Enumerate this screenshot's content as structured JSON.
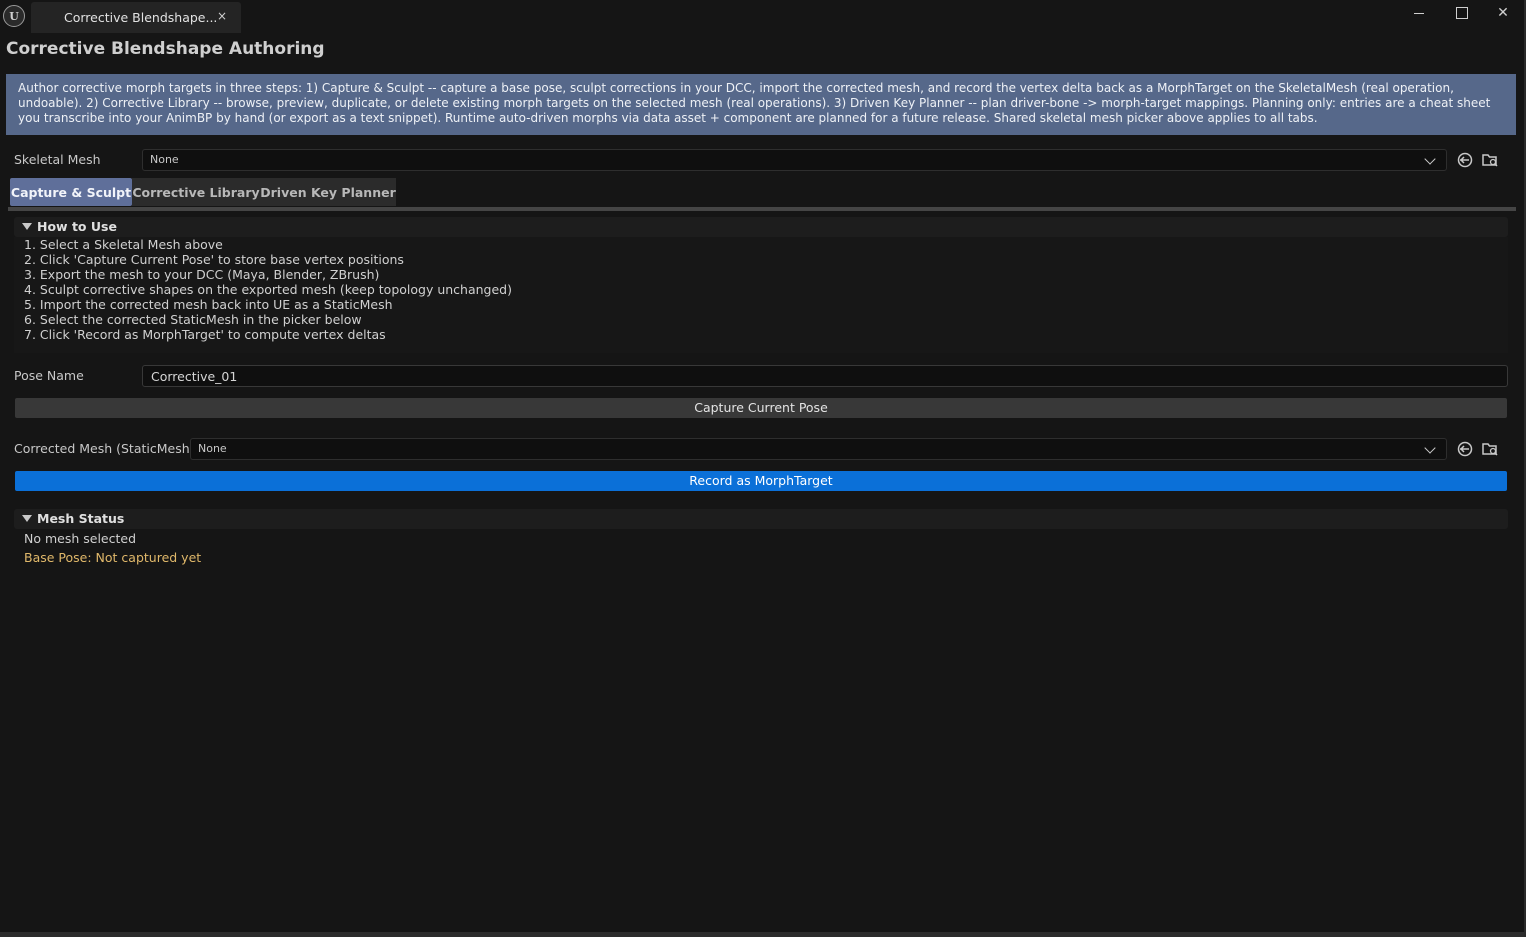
{
  "window": {
    "logo_text": "U",
    "tab_title": "Corrective Blendshape...",
    "tab_close": "×",
    "close_glyph": "✕"
  },
  "page": {
    "title": "Corrective Blendshape Authoring",
    "info_text": "Author corrective morph targets in three steps: 1) Capture & Sculpt -- capture a base pose, sculpt corrections in your DCC, import the corrected mesh, and record the vertex delta back as a MorphTarget on the SkeletalMesh (real operation, undoable). 2) Corrective Library -- browse, preview, duplicate, or delete existing morph targets on the selected mesh (real operations). 3) Driven Key Planner -- plan driver-bone -> morph-target mappings. Planning only: entries are a cheat sheet you transcribe into your AnimBP by hand (or export as a text snippet). Runtime auto-driven morphs via data asset + component are planned for a future release. Shared skeletal mesh picker above applies to all tabs."
  },
  "skeletal_mesh": {
    "label": "Skeletal Mesh",
    "value": "None"
  },
  "tabs": [
    {
      "label": "Capture & Sculpt",
      "active": true
    },
    {
      "label": "Corrective Library",
      "active": false
    },
    {
      "label": "Driven Key Planner",
      "active": false
    }
  ],
  "how_to_use": {
    "title": "How to Use",
    "steps": [
      "1. Select a Skeletal Mesh above",
      "2. Click 'Capture Current Pose' to store base vertex positions",
      "3. Export the mesh to your DCC (Maya, Blender, ZBrush)",
      "4. Sculpt corrective shapes on the exported mesh (keep topology unchanged)",
      "5. Import the corrected mesh back into UE as a StaticMesh",
      "6. Select the corrected StaticMesh in the picker below",
      "7. Click 'Record as MorphTarget' to compute vertex deltas"
    ]
  },
  "pose_name": {
    "label": "Pose Name",
    "value": "Corrective_01"
  },
  "capture_button": "Capture Current Pose",
  "corrected_mesh": {
    "label": "Corrected Mesh (StaticMesh)",
    "value": "None"
  },
  "record_button": "Record as MorphTarget",
  "mesh_status": {
    "title": "Mesh Status",
    "selection": "No mesh selected",
    "base_pose": "Base Pose: Not captured yet"
  },
  "colors": {
    "accent_blue": "#0b70d8",
    "info_box": "#56688a",
    "active_tab": "#5f6f9a",
    "warning_text": "#e0b86a"
  }
}
